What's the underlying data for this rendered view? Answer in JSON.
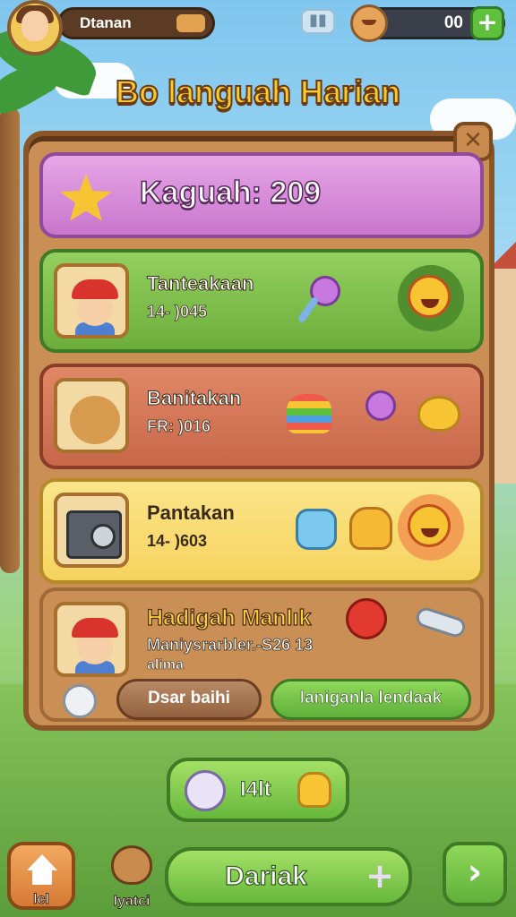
{
  "header": {
    "player_name": "Dtanan",
    "coin_count": "00",
    "title": "Bo languah Harian"
  },
  "score_card": {
    "text": "Kaguah: 209"
  },
  "tasks": [
    {
      "name": "Tanteakaan",
      "progress": "14- )045"
    },
    {
      "name": "Banitakan",
      "progress": "FR: )016"
    },
    {
      "name": "Pantakan",
      "progress": "14- )603"
    }
  ],
  "reward": {
    "title": "Hadigah Manlık",
    "desc": "Maniysrarbler.-S26 13",
    "desc2": "alima",
    "button_secondary": "Dsar baihi",
    "button_primary": "laniganla lendaak"
  },
  "claim": {
    "label": "I4lt"
  },
  "bottom_nav": {
    "home_label": "lcl",
    "pet_label": "Iyatci",
    "main_label": "Dariak",
    "main_plus": "+",
    "next_label": "›"
  },
  "icons": {
    "plus": "+",
    "close": "✕"
  }
}
